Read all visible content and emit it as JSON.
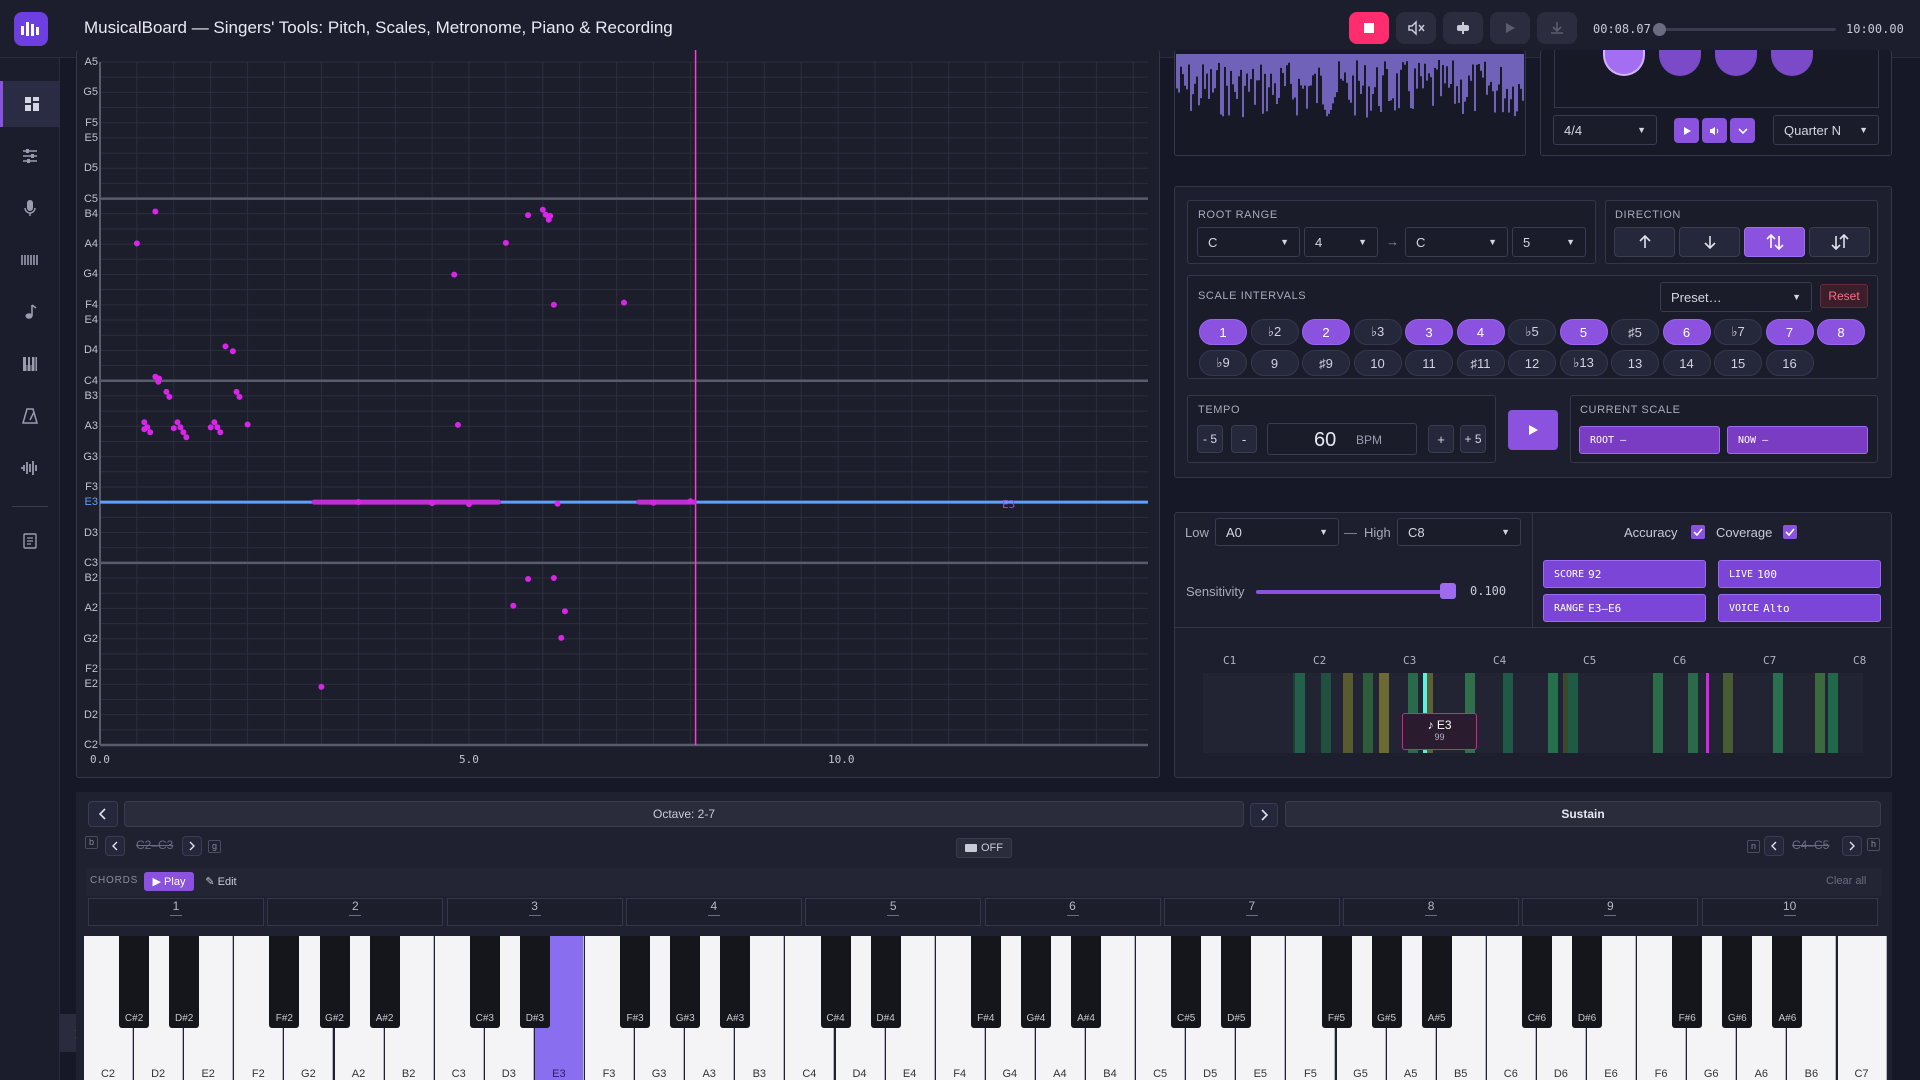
{
  "app": {
    "title": "MusicalBoard — Singers' Tools: Pitch, Scales, Metronome, Piano & Recording"
  },
  "transport": {
    "time": "00:08.07",
    "total": "10:00.00",
    "progress": 0.013
  },
  "sidebar": {
    "items": [
      "dashboard-icon",
      "sliders-icon",
      "microphone-icon",
      "waveform-bars-icon",
      "music-note-icon",
      "piano-icon",
      "metronome-icon",
      "audio-wave-icon",
      "notes-icon"
    ]
  },
  "pitch_chart": {
    "y_labels": [
      "A5",
      "G5",
      "F5",
      "E5",
      "D5",
      "C5",
      "B4",
      "A4",
      "G4",
      "F4",
      "E4",
      "D4",
      "C4",
      "B3",
      "A3",
      "G3",
      "F3",
      "E3",
      "D3",
      "C3",
      "B2",
      "A2",
      "G2",
      "F2",
      "E2",
      "D2",
      "C2"
    ],
    "x_labels": [
      "0.0",
      "5.0",
      "10.0"
    ],
    "target_note": "E3",
    "playhead_label": "E3",
    "accent": "#ff3cd6"
  },
  "chart_data": {
    "type": "scatter",
    "title": "",
    "xlabel": "",
    "ylabel": "",
    "x_ticks": [
      0,
      5,
      10
    ],
    "x_range": [
      0,
      14.2
    ],
    "y_range_notes": [
      "C2",
      "A5"
    ],
    "series": [
      {
        "values": [
          [
            0.5,
            "A4"
          ],
          [
            0.75,
            "B4"
          ],
          [
            0.6,
            "A3"
          ],
          [
            0.8,
            "C4"
          ],
          [
            1.0,
            "A3"
          ],
          [
            1.5,
            "A3"
          ],
          [
            1.8,
            "D4"
          ],
          [
            2.0,
            "A3"
          ],
          [
            3.0,
            "E2"
          ],
          [
            3.5,
            "E3"
          ],
          [
            4.5,
            "E3"
          ],
          [
            4.8,
            "G4"
          ],
          [
            4.85,
            "A3"
          ],
          [
            5.0,
            "E3"
          ],
          [
            5.5,
            "A4"
          ],
          [
            5.8,
            "B4"
          ],
          [
            6.1,
            "B4"
          ],
          [
            6.15,
            "F4"
          ],
          [
            6.2,
            "E3"
          ],
          [
            5.6,
            "A2"
          ],
          [
            5.8,
            "B2"
          ],
          [
            6.15,
            "B2"
          ],
          [
            6.3,
            "A2"
          ],
          [
            6.25,
            "G2"
          ],
          [
            7.1,
            "F4"
          ],
          [
            7.5,
            "E3"
          ],
          [
            8.0,
            "E3"
          ]
        ]
      }
    ]
  },
  "waveform": {},
  "metronome": {
    "time_signature": "4/4",
    "subdivision": "Quarter N"
  },
  "root_range": {
    "label": "ROOT RANGE",
    "from_note": "C",
    "from_octave": "4",
    "arrow": "→",
    "to_note": "C",
    "to_octave": "5"
  },
  "direction": {
    "label": "DIRECTION",
    "options": [
      "up-arrow-icon",
      "down-arrow-icon",
      "up-down-icon",
      "down-up-icon"
    ],
    "active": 2
  },
  "intervals": {
    "label": "SCALE INTERVALS",
    "preset": "Preset…",
    "reset": "Reset",
    "row1": [
      {
        "t": "1",
        "on": true
      },
      {
        "t": "♭2",
        "on": false
      },
      {
        "t": "2",
        "on": true
      },
      {
        "t": "♭3",
        "on": false
      },
      {
        "t": "3",
        "on": true
      },
      {
        "t": "4",
        "on": true
      },
      {
        "t": "♭5",
        "on": false
      },
      {
        "t": "5",
        "on": true
      },
      {
        "t": "♯5",
        "on": false
      },
      {
        "t": "6",
        "on": true
      },
      {
        "t": "♭7",
        "on": false
      },
      {
        "t": "7",
        "on": true
      },
      {
        "t": "8",
        "on": true
      }
    ],
    "row2": [
      {
        "t": "♭9",
        "on": false
      },
      {
        "t": "9",
        "on": false
      },
      {
        "t": "♯9",
        "on": false
      },
      {
        "t": "10",
        "on": false
      },
      {
        "t": "11",
        "on": false
      },
      {
        "t": "♯11",
        "on": false
      },
      {
        "t": "12",
        "on": false
      },
      {
        "t": "♭13",
        "on": false
      },
      {
        "t": "13",
        "on": false
      },
      {
        "t": "14",
        "on": false
      },
      {
        "t": "15",
        "on": false
      },
      {
        "t": "16",
        "on": false
      }
    ]
  },
  "tempo": {
    "label": "TEMPO",
    "minus5": "- 5",
    "minus": "-",
    "value": "60",
    "unit": "BPM",
    "plus": "+",
    "plus5": "+ 5"
  },
  "current_scale": {
    "label": "CURRENT SCALE",
    "root": "ROOT —",
    "now": "NOW —"
  },
  "analysis": {
    "low_label": "Low",
    "low": "A0",
    "dash": "—",
    "high_label": "High",
    "high": "C8",
    "accuracy": "Accuracy",
    "coverage": "Coverage",
    "sensitivity_label": "Sensitivity",
    "sensitivity": "0.100",
    "sensitivity_level": 0.98,
    "cards": [
      {
        "k": "SCORE",
        "v": "92"
      },
      {
        "k": "LIVE",
        "v": "100"
      },
      {
        "k": "RANGE",
        "v": "E3–E6"
      },
      {
        "k": "VOICE",
        "v": "Alto"
      }
    ],
    "octaves": [
      "C1",
      "C2",
      "C3",
      "C4",
      "C5",
      "C6",
      "C7",
      "C8"
    ],
    "tooltip_note": "♪ E3",
    "tooltip_value": "99"
  },
  "piano": {
    "octave": "Octave: 2-7",
    "sustain": "Sustain",
    "left_range": "C2–C3",
    "right_range": "C4–C5",
    "toggle": "OFF",
    "left_key_b": "b",
    "left_key_g": "g",
    "right_key_n": "n",
    "right_key_h": "h",
    "chords_label": "CHORDS",
    "play": "▶ Play",
    "edit": "✎ Edit",
    "clear": "Clear all",
    "slots": [
      "1",
      "2",
      "3",
      "4",
      "5",
      "6",
      "7",
      "8",
      "9",
      "10"
    ],
    "white_keys": [
      "C2",
      "D2",
      "E2",
      "F2",
      "G2",
      "A2",
      "B2",
      "C3",
      "D3",
      "E3",
      "F3",
      "G3",
      "A3",
      "B3",
      "C4",
      "D4",
      "E4",
      "F4",
      "G4",
      "A4",
      "B4",
      "C5",
      "D5",
      "E5",
      "F5",
      "G5",
      "A5",
      "B5",
      "C6",
      "D6",
      "E6",
      "F6",
      "G6",
      "A6",
      "B6",
      "C7"
    ],
    "black_keys": [
      "C#2",
      "D#2",
      "F#2",
      "G#2",
      "A#2",
      "C#3",
      "D#3",
      "F#3",
      "G#3",
      "A#3",
      "C#4",
      "D#4",
      "F#4",
      "G#4",
      "A#4",
      "C#5",
      "D#5",
      "F#5",
      "G#5",
      "A#5",
      "C#6",
      "D#6",
      "F#6",
      "G#6",
      "A#6"
    ],
    "active_key": "E3"
  }
}
